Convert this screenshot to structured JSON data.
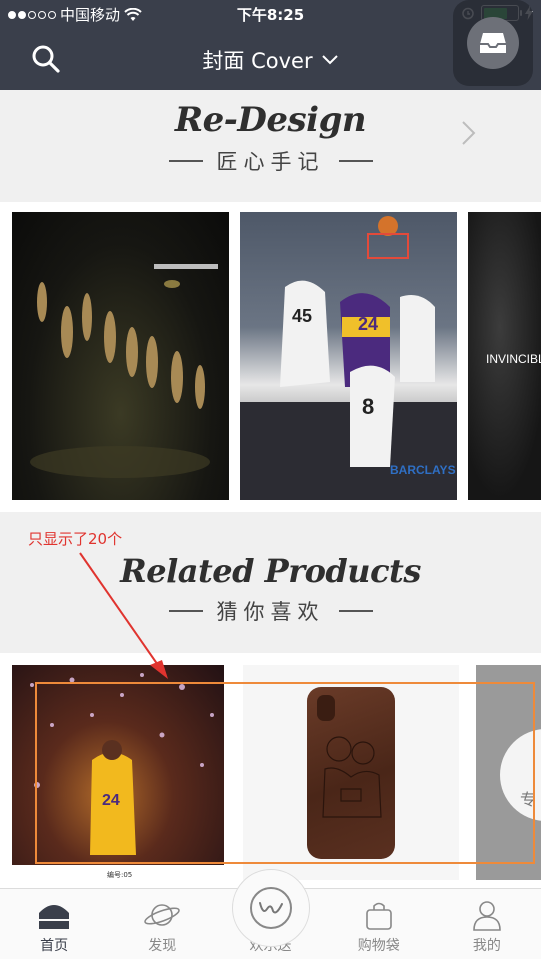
{
  "status_bar": {
    "carrier": "中国移动",
    "time": "下午8:25"
  },
  "nav": {
    "title": "封面 Cover",
    "search_icon": "search-icon",
    "dropdown_icon": "chevron-down-icon"
  },
  "redesign": {
    "title": "Re-Design",
    "subtitle": "匠心手记",
    "tile3_caption": "INVINCIBLE."
  },
  "related": {
    "title": "Related Products",
    "subtitle": "猜你喜欢",
    "tile1_note": "编号:05"
  },
  "annotation": {
    "text": "只显示了20个"
  },
  "tabs": [
    {
      "label": "首页",
      "icon": "home-icon",
      "active": true
    },
    {
      "label": "发现",
      "icon": "planet-icon",
      "active": false
    },
    {
      "label": "欢乐送",
      "icon": "w-logo-icon",
      "active": false
    },
    {
      "label": "购物袋",
      "icon": "bag-icon",
      "active": false
    },
    {
      "label": "我的",
      "icon": "person-icon",
      "active": false
    }
  ],
  "colors": {
    "header_bg": "#3a3f4b",
    "section_bg": "#f0f0f0",
    "annotation": "#e0342f",
    "highlight": "#ee8a3a",
    "battery": "#39d353"
  }
}
